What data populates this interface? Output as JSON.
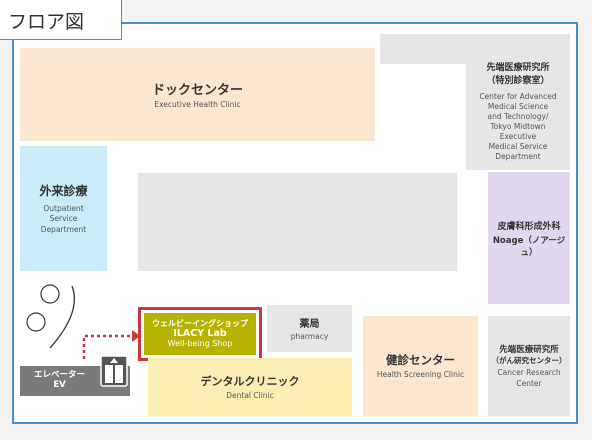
{
  "tab": {
    "title": "フロア図"
  },
  "rooms": {
    "dock": {
      "name_jp": "ドックセンター",
      "name_en": "Executive Health Clinic"
    },
    "advanced": {
      "name_jp": "先端医療研究所",
      "name_jp2": "（特別診察室）",
      "en_lines": [
        "Center for Advanced",
        "Medical Science",
        "and Technology/",
        "Tokyo Midtown",
        "Executive",
        "Medical Service Department"
      ]
    },
    "outpatient": {
      "name_jp": "外来診療",
      "en_lines": [
        "Outpatient",
        "Service",
        "Department"
      ]
    },
    "derm": {
      "name_jp": "皮膚科形成外科",
      "name_sub": "Noage（ノアージュ）"
    },
    "ilacy": {
      "line1": "ウェルビーイングショップ",
      "line2": "ILACY Lab",
      "line3": "Well-being Shop"
    },
    "pharmacy": {
      "name_jp": "薬局",
      "name_en": "pharmacy"
    },
    "kenshin": {
      "name_jp": "健診センター",
      "name_en": "Health Screening Clinic"
    },
    "cancer": {
      "name_jp": "先端医療研究所",
      "name_jp2": "（がん研究センター）",
      "name_en": "Cancer Research Center"
    },
    "dental": {
      "name_jp": "デンタルクリニック",
      "name_en": "Dental Clinic"
    },
    "elevator": {
      "name_jp": "エレベーター",
      "name_en": "EV"
    }
  },
  "colors": {
    "border": "#4a90c8",
    "highlight": "#c8373a",
    "shop": "#b5b300",
    "arrow": "#c8373a"
  },
  "icons": {
    "elevator": "elevator-icon",
    "circle": "round-table-icon"
  }
}
